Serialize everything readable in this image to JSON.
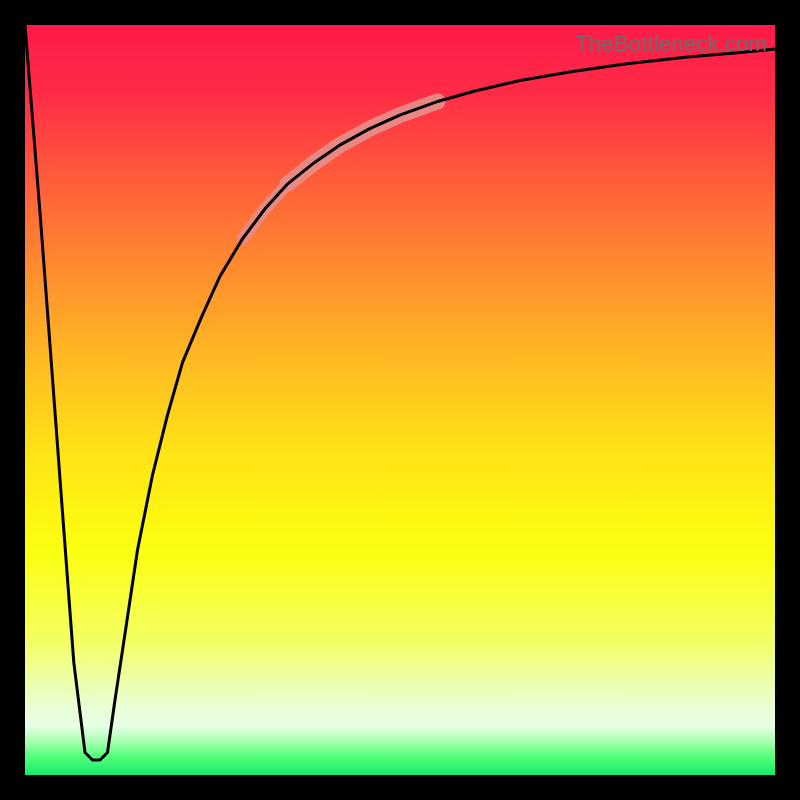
{
  "watermark": "TheBottleneck.com",
  "gradient_stops": [
    {
      "offset": 0.0,
      "color": "#ff1a49"
    },
    {
      "offset": 0.09,
      "color": "#ff2b46"
    },
    {
      "offset": 0.2,
      "color": "#ff5a3b"
    },
    {
      "offset": 0.32,
      "color": "#ff8a2f"
    },
    {
      "offset": 0.45,
      "color": "#ffbb22"
    },
    {
      "offset": 0.58,
      "color": "#ffe615"
    },
    {
      "offset": 0.7,
      "color": "#fbff10"
    },
    {
      "offset": 0.82,
      "color": "#f4ff62"
    },
    {
      "offset": 0.88,
      "color": "#ecffb0"
    },
    {
      "offset": 0.91,
      "color": "#e9ffd6"
    },
    {
      "offset": 0.935,
      "color": "#e6ffe6"
    },
    {
      "offset": 0.955,
      "color": "#a9ffb0"
    },
    {
      "offset": 0.975,
      "color": "#55ff7a"
    },
    {
      "offset": 1.0,
      "color": "#14e96b"
    }
  ],
  "highlight": {
    "color": "#e88b86",
    "segments": [
      {
        "i0": 11,
        "i1": 16,
        "width": 16
      },
      {
        "i0": 9,
        "i1": 11,
        "width": 12
      }
    ]
  },
  "curve_color": "#000000",
  "curve_width": 3,
  "chart_data": {
    "type": "line",
    "title": "",
    "xlabel": "",
    "ylabel": "",
    "x_range": [
      0,
      100
    ],
    "y_range": [
      0,
      100
    ],
    "note": "Axes are unlabeled in source image; x and y are normalized 0–100 inside the plot area.",
    "series": [
      {
        "name": "left-descent",
        "x": [
          0.0,
          2.0,
          3.5,
          5.0,
          6.5,
          8.0
        ],
        "y": [
          100.0,
          75.0,
          55.0,
          35.0,
          15.0,
          3.0
        ]
      },
      {
        "name": "valley",
        "x": [
          8.0,
          9.0,
          10.0,
          11.0
        ],
        "y": [
          3.0,
          2.0,
          2.0,
          3.0
        ]
      },
      {
        "name": "right-rise",
        "x": [
          11.0,
          12.0,
          13.5,
          15.0,
          17.0,
          19.0,
          21.0,
          23.5,
          26.0,
          29.0,
          32.0,
          35.0,
          38.5,
          42.0,
          46.0,
          50.0,
          55.0,
          60.0,
          66.0,
          73.0,
          80.0,
          88.0,
          95.0,
          100.0
        ],
        "y": [
          3.0,
          10.0,
          20.0,
          30.0,
          40.0,
          48.0,
          55.0,
          61.0,
          66.5,
          71.5,
          75.5,
          78.8,
          81.6,
          84.0,
          86.2,
          88.0,
          89.8,
          91.2,
          92.6,
          93.8,
          94.8,
          95.7,
          96.3,
          96.8
        ]
      }
    ],
    "highlighted_region": {
      "description": "thick salmon overlay on the steep rising limb",
      "approx_x_range": [
        19,
        26
      ],
      "approx_y_range": [
        48,
        67
      ]
    }
  }
}
